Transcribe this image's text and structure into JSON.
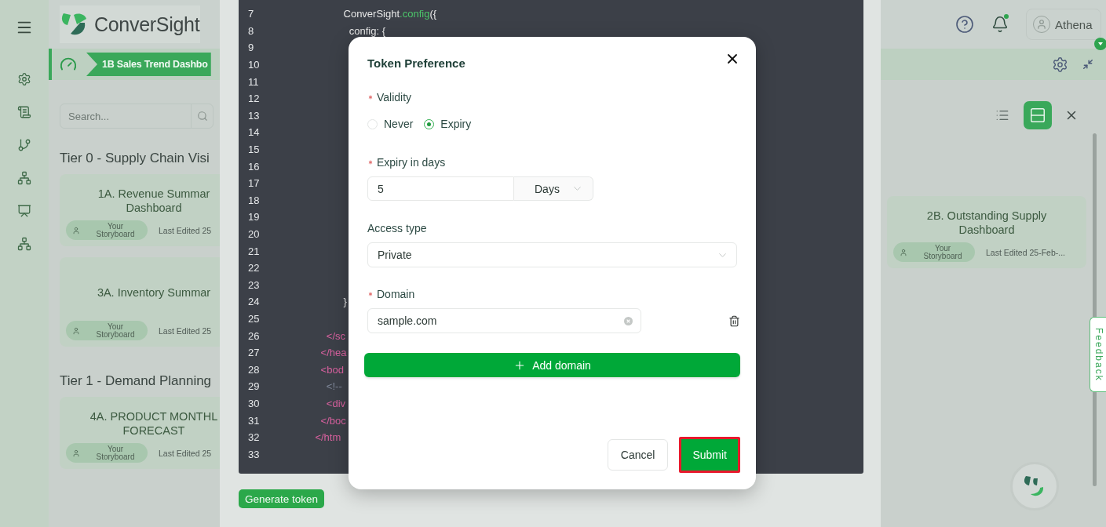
{
  "header": {
    "brand": "ConverSight",
    "notifications": {
      "unread": true
    },
    "user": {
      "name": "Athena"
    }
  },
  "breadcrumb": {
    "tab": "1B Sales Trend Dashbo"
  },
  "search": {
    "placeholder": "Search..."
  },
  "view_toggle": [
    {
      "kind": "list",
      "selected": false
    },
    {
      "kind": "grid",
      "selected": true
    }
  ],
  "left_column": {
    "sections": [
      {
        "title": "Tier 0 - Supply Chain Visi",
        "cards": [
          {
            "title_lines": [
              "1A. Revenue Summar",
              "Dashboard"
            ],
            "owner": "Your Storyboard",
            "edited": "Last Edited 25"
          },
          {
            "title_lines": [
              "3A. Inventory Summar"
            ],
            "owner": "Your Storyboard",
            "edited": "Last Edited 25"
          }
        ]
      },
      {
        "title": "Tier 1 - Demand Planning",
        "cards": [
          {
            "title_lines": [
              "4A. PRODUCT MONTHL",
              "FORECAST"
            ],
            "owner": "Your Storyboard",
            "edited": "Last Edited 25"
          }
        ]
      }
    ]
  },
  "right_column": {
    "cards": [
      {
        "title_lines": [
          "2B. Outstanding Supply",
          "Dashboard"
        ],
        "owner": "Your Storyboard",
        "edited": "Last Edited 25-Feb-..."
      }
    ]
  },
  "code": {
    "lines": [
      {
        "number": "7",
        "segments": [
          {
            "text": "                           ConverSight",
            "kind": "plain"
          },
          {
            "text": ".config",
            "kind": "method"
          },
          {
            "text": "({",
            "kind": "plain"
          }
        ]
      },
      {
        "number": "8",
        "segments": [
          {
            "text": "                             config: {",
            "kind": "plain"
          }
        ]
      },
      {
        "number": "9"
      },
      {
        "number": "10"
      },
      {
        "number": "11"
      },
      {
        "number": "12"
      },
      {
        "number": "13"
      },
      {
        "number": "14"
      },
      {
        "number": "15"
      },
      {
        "number": "16"
      },
      {
        "number": "17"
      },
      {
        "number": "18"
      },
      {
        "number": "19"
      },
      {
        "number": "20"
      },
      {
        "number": "21"
      },
      {
        "number": "22"
      },
      {
        "number": "23"
      },
      {
        "number": "24",
        "segments": [
          {
            "text": "                           }",
            "kind": "plain"
          }
        ]
      },
      {
        "number": "25"
      },
      {
        "number": "26",
        "segments": [
          {
            "text": "                     </sc",
            "kind": "tag"
          }
        ]
      },
      {
        "number": "27",
        "segments": [
          {
            "text": "                   </hea",
            "kind": "tag"
          }
        ]
      },
      {
        "number": "28",
        "segments": [
          {
            "text": "                   <bod",
            "kind": "tag"
          }
        ]
      },
      {
        "number": "29",
        "segments": [
          {
            "text": "                     <!--",
            "kind": "comment"
          }
        ]
      },
      {
        "number": "30",
        "segments": [
          {
            "text": "                     <div",
            "kind": "tag"
          }
        ]
      },
      {
        "number": "31",
        "segments": [
          {
            "text": "                   </boc",
            "kind": "tag"
          }
        ]
      },
      {
        "number": "32",
        "segments": [
          {
            "text": "                 </htm",
            "kind": "tag"
          }
        ]
      },
      {
        "number": "33"
      }
    ]
  },
  "generate_button": "Generate token",
  "dialog": {
    "title": "Token Preference",
    "validity": {
      "label": "Validity",
      "required": true,
      "options": [
        {
          "label": "Never",
          "selected": false
        },
        {
          "label": "Expiry",
          "selected": true
        }
      ]
    },
    "expiry": {
      "label": "Expiry in days",
      "required": true,
      "value": "5",
      "unit": "Days"
    },
    "access": {
      "label": "Access type",
      "value": "Private"
    },
    "domain": {
      "label": "Domain",
      "required": true,
      "entries": [
        {
          "value": "sample.com"
        }
      ]
    },
    "add_button": "Add domain",
    "buttons": [
      {
        "label": "Cancel",
        "kind": "secondary",
        "highlighted": false
      },
      {
        "label": "Submit",
        "kind": "primary",
        "highlighted": true
      }
    ]
  },
  "feedback_tab": "Feedback"
}
